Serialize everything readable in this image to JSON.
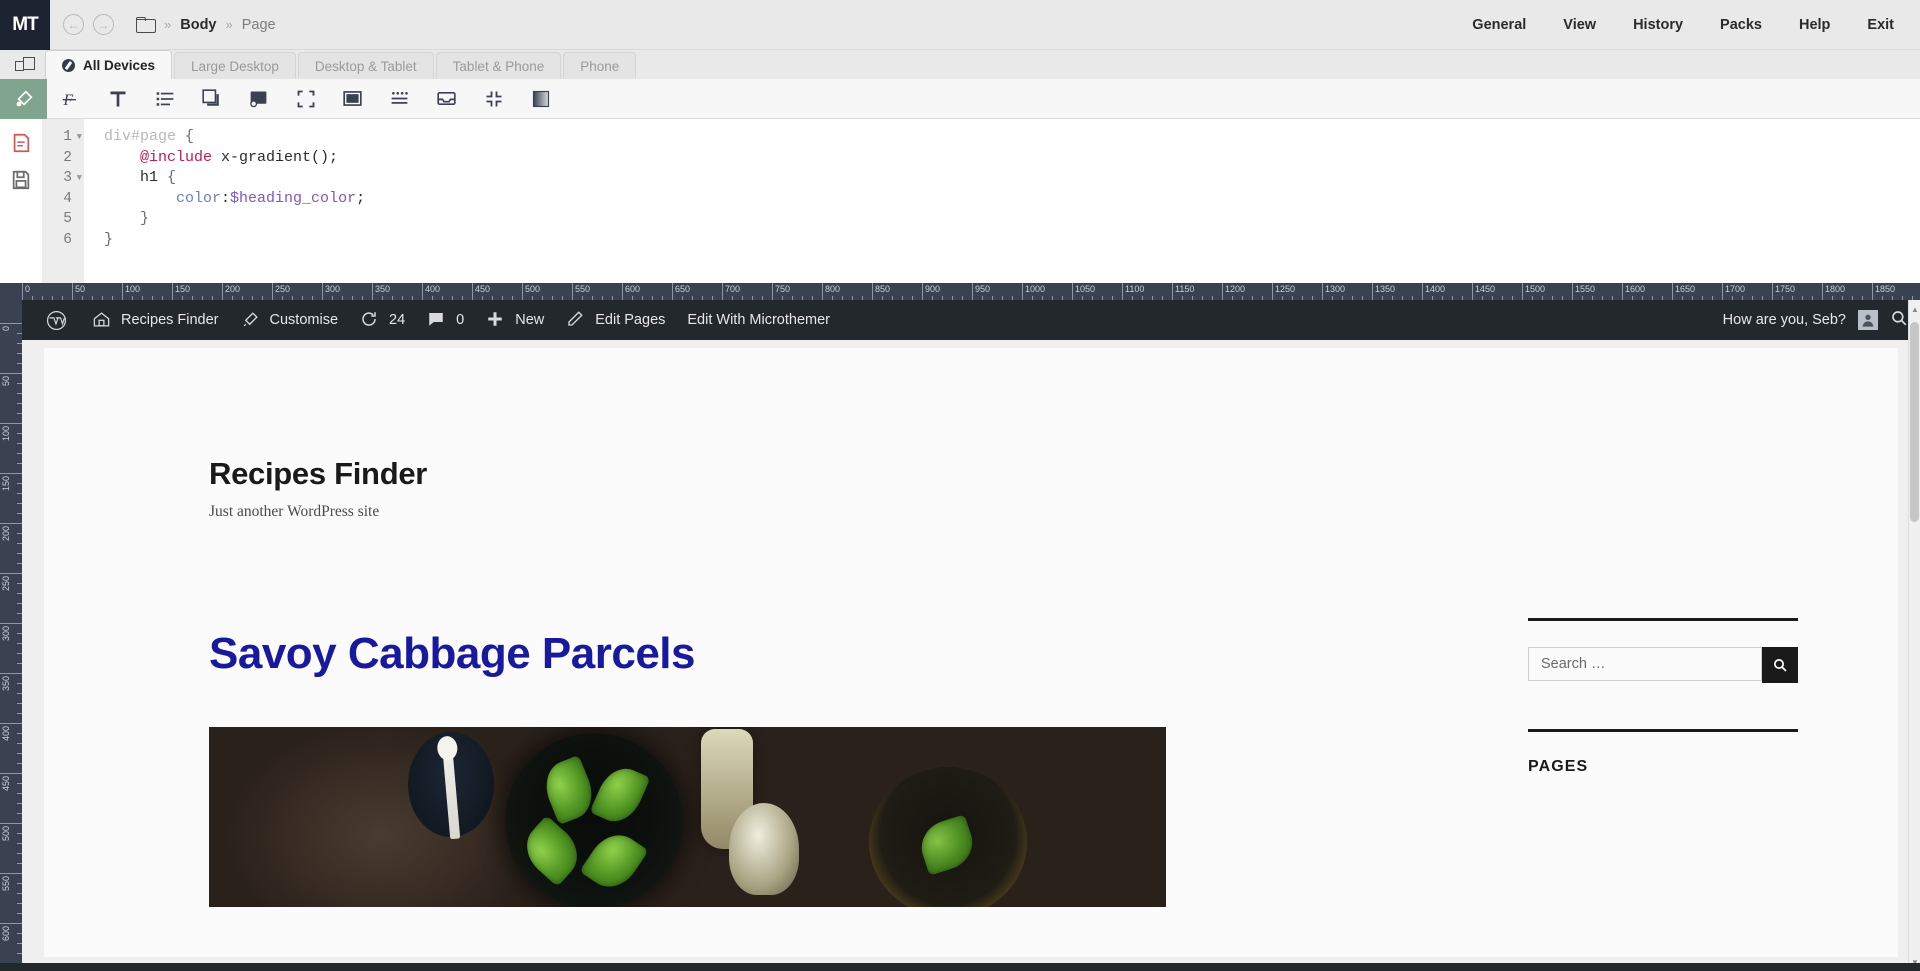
{
  "app": {
    "logo_m": "MT",
    "breadcrumb": {
      "body": "Body",
      "separator": "»",
      "page": "Page",
      "folder_icon": "folder-icon"
    },
    "menu": [
      "General",
      "View",
      "History",
      "Packs",
      "Help",
      "Exit"
    ]
  },
  "device_tabs": [
    {
      "label": "All Devices",
      "active": true
    },
    {
      "label": "Large Desktop",
      "active": false
    },
    {
      "label": "Desktop & Tablet",
      "active": false
    },
    {
      "label": "Tablet & Phone",
      "active": false
    },
    {
      "label": "Phone",
      "active": false
    }
  ],
  "toolbar": {
    "icons": [
      "code-brush-icon",
      "font-icon",
      "typography-icon",
      "list-icon",
      "box-shadow-icon",
      "background-icon",
      "fullscreen-icon",
      "layout-panel-icon",
      "border-dots-icon",
      "inbox-icon",
      "collapse-icon",
      "gradient-icon"
    ]
  },
  "code": {
    "lines": [
      "1",
      "2",
      "3",
      "4",
      "5",
      "6"
    ],
    "fold_lines": [
      "1",
      "3"
    ],
    "text": [
      {
        "parts": [
          {
            "t": "div#page ",
            "c": "c-sel"
          },
          {
            "t": "{",
            "c": "c-brace"
          }
        ]
      },
      {
        "parts": [
          {
            "t": "    ",
            "c": "c-plain"
          },
          {
            "t": "@include",
            "c": "c-at"
          },
          {
            "t": " x-gradient();",
            "c": "c-plain"
          }
        ]
      },
      {
        "parts": [
          {
            "t": "    h1 ",
            "c": "c-tag"
          },
          {
            "t": "{",
            "c": "c-brace"
          }
        ]
      },
      {
        "parts": [
          {
            "t": "        ",
            "c": "c-plain"
          },
          {
            "t": "color",
            "c": "c-prop"
          },
          {
            "t": ":",
            "c": "c-plain"
          },
          {
            "t": "$heading_color",
            "c": "c-var"
          },
          {
            "t": ";",
            "c": "c-plain"
          }
        ]
      },
      {
        "parts": [
          {
            "t": "    }",
            "c": "c-brace"
          }
        ]
      },
      {
        "parts": [
          {
            "t": "}",
            "c": "c-brace"
          }
        ]
      }
    ]
  },
  "ruler": {
    "h_labels": [
      "0",
      "50",
      "100",
      "150",
      "200",
      "250",
      "300",
      "350",
      "400",
      "450",
      "500",
      "550",
      "600",
      "650",
      "700",
      "750",
      "800",
      "850",
      "900",
      "950",
      "1000",
      "1050",
      "1100",
      "1150",
      "1200",
      "1250",
      "1300",
      "1350",
      "1400",
      "1450",
      "1500"
    ],
    "v_labels": [
      "0",
      "50",
      "100",
      "150",
      "200"
    ]
  },
  "wp_adminbar": {
    "logo_icon": "wordpress-icon",
    "site_name": "Recipes Finder",
    "site_icon": "dashboard-icon",
    "customise": "Customise",
    "customise_icon": "brush-icon",
    "updates_icon": "updates-icon",
    "updates_count": "24",
    "comments_icon": "comment-icon",
    "comments_count": "0",
    "new_icon": "plus-icon",
    "new_label": "New",
    "edit_pages_icon": "pencil-icon",
    "edit_pages": "Edit Pages",
    "edit_microthemer": "Edit With Microthemer",
    "greeting": "How are you, Seb?",
    "avatar": "avatar",
    "search_icon": "search-icon"
  },
  "site": {
    "title": "Recipes Finder",
    "tagline": "Just another WordPress site",
    "entry_title": "Savoy Cabbage Parcels",
    "featured_image_alt": "savoy-cabbage-parcels-photo"
  },
  "sidebar": {
    "search_placeholder": "Search …",
    "search_value": "",
    "search_button_icon": "search-icon",
    "pages_widget_title": "PAGES"
  },
  "colors": {
    "accent_green": "#7fa58f",
    "admin_bar": "#23282d",
    "ruler": "#3a4252",
    "heading_blue": "#18199c",
    "topbar_bg": "#e9e9e9"
  }
}
